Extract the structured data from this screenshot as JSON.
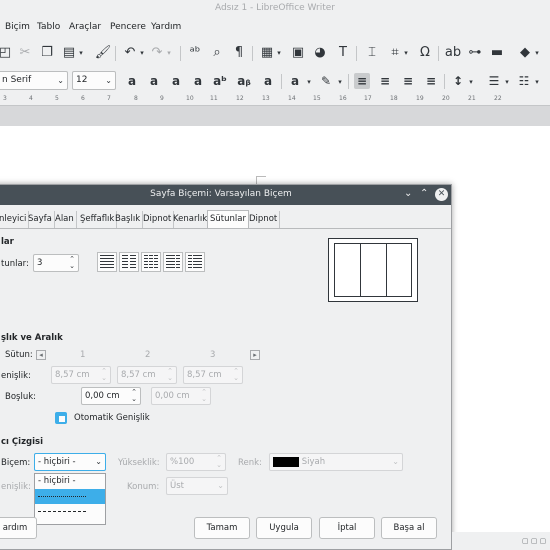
{
  "window": {
    "title": "Adsız 1 - LibreOffice Writer"
  },
  "menu": [
    "Biçim",
    "Tablo",
    "Araçlar",
    "Pencere",
    "Yardım"
  ],
  "toolbar2": {
    "font_name": "n Serif",
    "font_size": "12"
  },
  "ruler": [
    "3",
    "4",
    "5",
    "6",
    "7",
    "8",
    "9",
    "10",
    "11",
    "12",
    "13",
    "14",
    "15",
    "16",
    "17",
    "18",
    "19",
    "20",
    "21",
    "22"
  ],
  "dialog": {
    "title": "Sayfa Biçemi: Varsayılan Biçem",
    "tabs": [
      "nleyici",
      "Sayfa",
      "Alan",
      "Şeffaflık",
      "Başlık",
      "Dipnot",
      "Kenarlık",
      "Sütunlar",
      "Dipnot"
    ],
    "active_tab": "Sütunlar",
    "columns_section": {
      "heading": "lar",
      "columns_label": "tunlar:",
      "columns_value": "3"
    },
    "width_section": {
      "heading": "şlık ve Aralık",
      "column_label": "Sütun:",
      "column_numbers": [
        "1",
        "2",
        "3"
      ],
      "width_label": "enişlik:",
      "widths": [
        "8,57 cm",
        "8,57 cm",
        "8,57 cm"
      ],
      "spacing_label": "Boşluk:",
      "spacings": [
        "0,00 cm",
        "0,00 cm"
      ],
      "autowidth_label": "Otomatik Genişlik",
      "autowidth_checked": true
    },
    "separator_section": {
      "heading": "cı Çizgisi",
      "style_label": "Biçem:",
      "style_value": "- hiçbiri -",
      "height_label": "Yükseklik:",
      "height_value": "%100",
      "color_label": "Renk:",
      "color_value": "Siyah",
      "width_label": "enişlik:",
      "position_label": "Konum:",
      "position_value": "Üst",
      "dropdown_items": [
        "- hiçbiri -"
      ]
    },
    "buttons": {
      "help": "ardım",
      "ok": "Tamam",
      "apply": "Uygula",
      "cancel": "İptal",
      "reset": "Başa al"
    }
  }
}
